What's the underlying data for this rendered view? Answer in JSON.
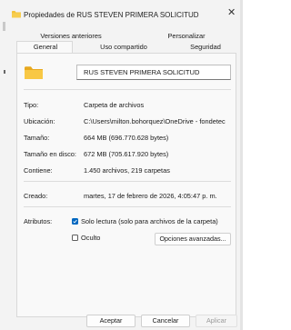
{
  "window": {
    "title": "Propiedades de RUS STEVEN PRIMERA SOLICITUD",
    "close_glyph": "✕"
  },
  "tabs": {
    "row1": [
      "Versiones anteriores",
      "Personalizar"
    ],
    "row2": [
      "General",
      "Uso compartido",
      "Seguridad"
    ],
    "active": "General"
  },
  "general": {
    "folder_name": "RUS STEVEN PRIMERA SOLICITUD",
    "folder_icon": "folder-icon",
    "tipo_label": "Tipo:",
    "tipo_value": "Carpeta de archivos",
    "ubicacion_label": "Ubicación:",
    "ubicacion_value": "C:\\Users\\milton.bohorquez\\OneDrive - fondetec",
    "tamano_label": "Tamaño:",
    "tamano_value": "664 MB (696.770.628 bytes)",
    "tamano_disco_label": "Tamaño en disco:",
    "tamano_disco_value": "672 MB (705.617.920 bytes)",
    "contiene_label": "Contiene:",
    "contiene_value": "1.450 archivos, 219 carpetas",
    "creado_label": "Creado:",
    "creado_value": "martes, 17 de febrero de 2026, 4:05:47 p. m.",
    "atributos_label": "Atributos:",
    "solo_lectura_label": "Solo lectura (solo para archivos de la carpeta)",
    "solo_lectura_checked": true,
    "oculto_label": "Oculto",
    "oculto_checked": false,
    "opciones_avanzadas_label": "Opciones avanzadas..."
  },
  "buttons": {
    "aceptar": "Aceptar",
    "cancelar": "Cancelar",
    "aplicar": "Aplicar"
  },
  "colors": {
    "accent": "#0067c0",
    "folder": "#f4c23a",
    "disabled_text": "#9a9a9a"
  }
}
